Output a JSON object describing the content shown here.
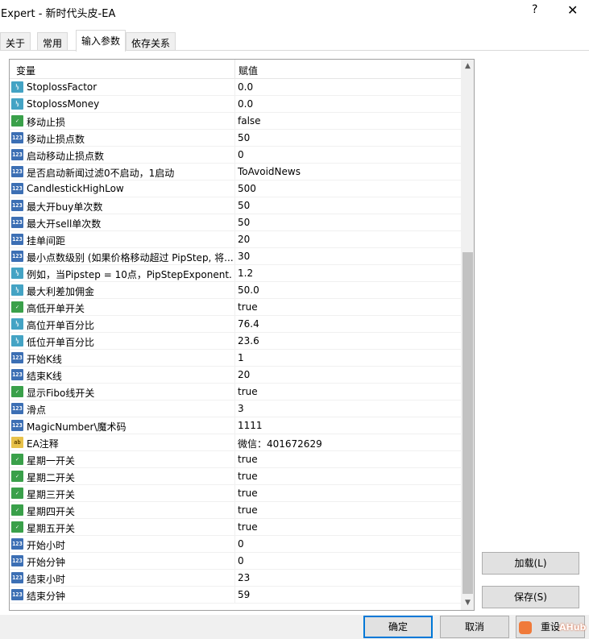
{
  "window": {
    "title": "Expert - 新时代头皮-EA",
    "help_label": "?",
    "close_label": "✕"
  },
  "tabs": [
    {
      "label": "关于"
    },
    {
      "label": "常用"
    },
    {
      "label": "输入参数"
    },
    {
      "label": "依存关系"
    }
  ],
  "active_tab": "输入参数",
  "grid": {
    "columns": [
      "变量",
      "赋值"
    ],
    "rows": [
      {
        "type": "dbl",
        "icon": "double-type-icon",
        "name": "StoplossFactor",
        "value": "0.0"
      },
      {
        "type": "dbl",
        "icon": "double-type-icon",
        "name": "StoplossMoney",
        "value": "0.0"
      },
      {
        "type": "bool",
        "icon": "bool-type-icon",
        "name": "移动止损",
        "value": "false"
      },
      {
        "type": "int",
        "icon": "int-type-icon",
        "name": "移动止损点数",
        "value": "50"
      },
      {
        "type": "int",
        "icon": "int-type-icon",
        "name": "启动移动止损点数",
        "value": "0"
      },
      {
        "type": "int",
        "icon": "int-type-icon",
        "name": "是否启动新闻过滤0不启动，1启动",
        "value": "ToAvoidNews"
      },
      {
        "type": "int",
        "icon": "int-type-icon",
        "name": "CandlestickHighLow",
        "value": "500"
      },
      {
        "type": "int",
        "icon": "int-type-icon",
        "name": "最大开buy单次数",
        "value": "50"
      },
      {
        "type": "int",
        "icon": "int-type-icon",
        "name": "最大开sell单次数",
        "value": "50"
      },
      {
        "type": "int",
        "icon": "int-type-icon",
        "name": "挂单间距",
        "value": "20"
      },
      {
        "type": "int",
        "icon": "int-type-icon",
        "name": "最小点数级别 (如果价格移动超过 PipStep, 将...",
        "value": "30"
      },
      {
        "type": "dbl",
        "icon": "double-type-icon",
        "name": "例如，当Pipstep = 10点，PipStepExponent...",
        "value": "1.2"
      },
      {
        "type": "dbl",
        "icon": "double-type-icon",
        "name": "最大利差加佣金",
        "value": "50.0"
      },
      {
        "type": "bool",
        "icon": "bool-type-icon",
        "name": "高低开单开关",
        "value": "true"
      },
      {
        "type": "dbl",
        "icon": "double-type-icon",
        "name": "高位开单百分比",
        "value": "76.4"
      },
      {
        "type": "dbl",
        "icon": "double-type-icon",
        "name": "低位开单百分比",
        "value": "23.6"
      },
      {
        "type": "int",
        "icon": "int-type-icon",
        "name": "开始K线",
        "value": "1"
      },
      {
        "type": "int",
        "icon": "int-type-icon",
        "name": "结束K线",
        "value": "20"
      },
      {
        "type": "bool",
        "icon": "bool-type-icon",
        "name": "显示Fibo线开关",
        "value": "true"
      },
      {
        "type": "int",
        "icon": "int-type-icon",
        "name": "滑点",
        "value": "3"
      },
      {
        "type": "int",
        "icon": "int-type-icon",
        "name": "MagicNumber\\魔术码",
        "value": "1111"
      },
      {
        "type": "str",
        "icon": "string-type-icon",
        "name": "EA注释",
        "value": "微信：401672629"
      },
      {
        "type": "bool",
        "icon": "bool-type-icon",
        "name": "星期一开关",
        "value": "true"
      },
      {
        "type": "bool",
        "icon": "bool-type-icon",
        "name": "星期二开关",
        "value": "true"
      },
      {
        "type": "bool",
        "icon": "bool-type-icon",
        "name": "星期三开关",
        "value": "true"
      },
      {
        "type": "bool",
        "icon": "bool-type-icon",
        "name": "星期四开关",
        "value": "true"
      },
      {
        "type": "bool",
        "icon": "bool-type-icon",
        "name": "星期五开关",
        "value": "true"
      },
      {
        "type": "int",
        "icon": "int-type-icon",
        "name": "开始小时",
        "value": "0"
      },
      {
        "type": "int",
        "icon": "int-type-icon",
        "name": "开始分钟",
        "value": "0"
      },
      {
        "type": "int",
        "icon": "int-type-icon",
        "name": "结束小时",
        "value": "23"
      },
      {
        "type": "int",
        "icon": "int-type-icon",
        "name": "结束分钟",
        "value": "59"
      }
    ],
    "type_glyphs": {
      "int": "123",
      "dbl": "½",
      "bool": "✓",
      "str": "ab"
    }
  },
  "side_buttons": {
    "load_label": "加载(L)",
    "save_label": "保存(S)"
  },
  "bottom_buttons": {
    "ok_label": "确定",
    "cancel_label": "取消",
    "reset_label": "重设"
  },
  "watermark": {
    "text": "AHub"
  },
  "colors": {
    "int_icon": "#3c6fb4",
    "double_icon": "#44a3c4",
    "bool_icon": "#3aa04a",
    "string_icon": "#e8c24a",
    "default_button_border": "#0078d7"
  }
}
